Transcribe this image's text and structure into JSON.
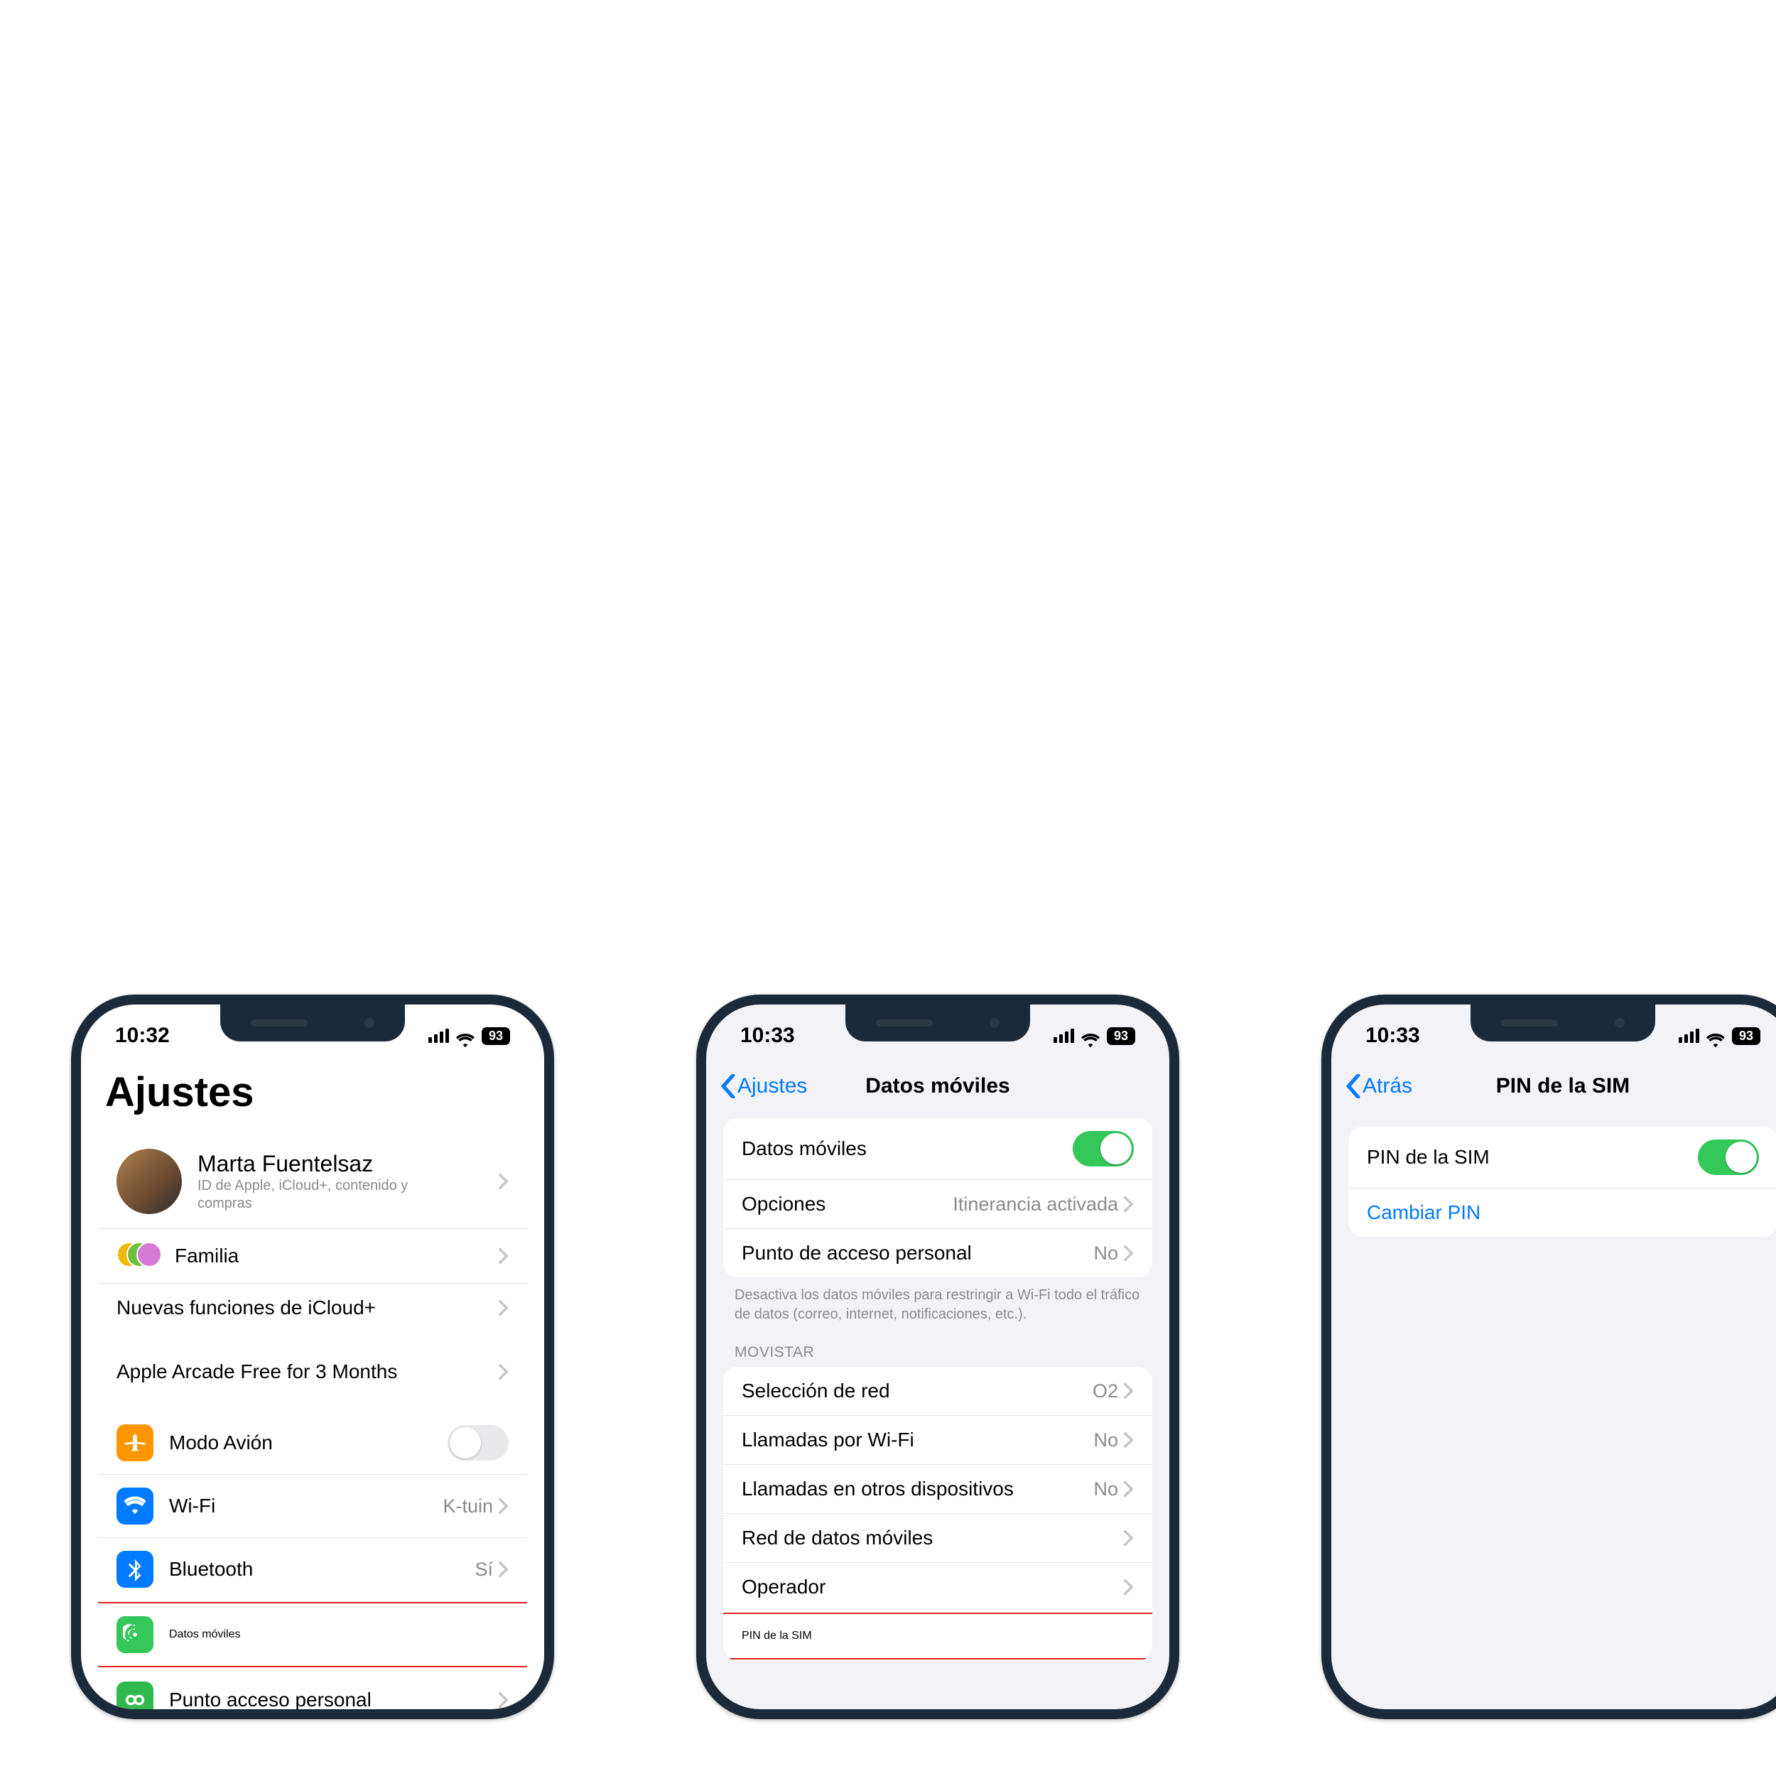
{
  "status": {
    "time1": "10:32",
    "time2": "10:33",
    "time3": "10:33",
    "battery": "93"
  },
  "phone1": {
    "title": "Ajustes",
    "user": {
      "name": "Marta Fuentelsaz",
      "sub": "ID de Apple, iCloud+, contenido y compras"
    },
    "family": "Familia",
    "icloud_new": "Nuevas funciones de iCloud+",
    "arcade": "Apple Arcade Free for 3 Months",
    "rows": {
      "airplane": "Modo Avión",
      "wifi": "Wi-Fi",
      "wifi_val": "K-tuin",
      "bluetooth": "Bluetooth",
      "bluetooth_val": "Sí",
      "cellular": "Datos móviles",
      "hotspot": "Punto acceso personal"
    }
  },
  "phone2": {
    "back": "Ajustes",
    "title": "Datos móviles",
    "rows": {
      "cellular": "Datos móviles",
      "options": "Opciones",
      "options_val": "Itinerancia activada",
      "hotspot": "Punto de acceso personal",
      "hotspot_val": "No"
    },
    "note": "Desactiva los datos móviles para restringir a Wi-Fi todo el tráfico de datos (correo, internet, notificaciones, etc.).",
    "carrier": "MOVISTAR",
    "rows2": {
      "network_sel": "Selección de red",
      "network_sel_val": "O2",
      "wifi_calling": "Llamadas por Wi-Fi",
      "wifi_calling_val": "No",
      "other_dev": "Llamadas en otros dispositivos",
      "other_dev_val": "No",
      "data_net": "Red de datos móviles",
      "operator": "Operador",
      "sim_pin": "PIN de la SIM"
    }
  },
  "phone3": {
    "back": "Atrás",
    "title": "PIN de la SIM",
    "rows": {
      "sim_pin": "PIN de la SIM",
      "change_pin": "Cambiar PIN"
    }
  }
}
